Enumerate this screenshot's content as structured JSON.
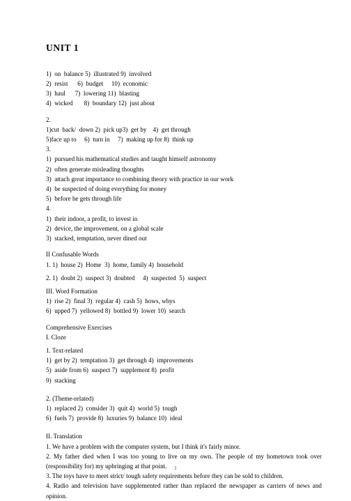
{
  "document": {
    "title": "UNIT 1",
    "page_number": "1"
  },
  "sections": {
    "vocabulary_1": {
      "lines": [
        "1)  on  balance 5)  illustrated 9)  involved",
        "2)  resist      6)  budget     10)  economic",
        "3)  haul      7)  lowering 11)  blasting",
        "4)  wicked       8)  boundary 12)  just about"
      ]
    },
    "section_2": {
      "marker": "2.",
      "lines": [
        "1)cut  back/  down 2)  pick up3)  get by    4)  get through",
        "5)face up to     6)  turn in     7)  making up for 8)  think up"
      ]
    },
    "section_3": {
      "marker": "3.",
      "lines": [
        "1)  pursued his mathematical studies and taught himself astronomy",
        "2)  often generate misleading thoughts",
        "3)  attach great importance to combining theory with practice in our work",
        "4)  be suspected of doing everything for money",
        "5)  before he gets through life"
      ]
    },
    "section_4": {
      "marker": "4.",
      "lines": [
        "1)  their indoor, a profit, to invest in",
        "2)  device, the improvement, on a global scale",
        "3)  stacked, temptation, never dined out"
      ]
    },
    "confusable_words": {
      "heading": "II Confusable Words",
      "lines": [
        "1. 1)  house 2)  Home  3)  home, family 4)  household",
        "2. 1)  doubt 2)  suspect 3)  doubted     4)  suspected  5)  suspect"
      ]
    },
    "word_formation": {
      "heading": "III. Word Formation",
      "lines": [
        "1)  rise 2)  final 3)  regular 4)  cash 5)  hows, whys",
        "6)  upped 7)  yellowed 8)  bottled 9)  lower 10)  search"
      ]
    },
    "comprehensive_exercises": {
      "heading": "Comprehensive Exercises",
      "cloze_heading": "I. Cloze",
      "text_related": {
        "label": "1. Text-related",
        "lines": [
          "1)  get by 2)  temptation 3)  get through 4)  improvements",
          "5)  aside from 6)  suspect 7)  supplement 8)  profit",
          "9)  stacking"
        ]
      },
      "theme_related": {
        "label": "2. (Theme-related)",
        "lines": [
          "1)  replaced 2)  consider 3)  quit 4)  world 5)  tough",
          "6)  fuels 7)  provide 8)  luxuries 9)  balance 10)  ideal"
        ]
      }
    },
    "translation": {
      "heading": "II. Translation",
      "items": [
        "1. We have a problem with the computer system, but I think it's fairly minor.",
        "2. My father died when I was too young to live on my own. The people of my hometown took over (responsibility for) my upbringing at that point.",
        "3. The toys have to meet strict/ tough safety requirements before they can be sold to children.",
        "4. Radio and television have supplemented rather than replaced the newspaper as carriers of news and opinion."
      ]
    }
  }
}
